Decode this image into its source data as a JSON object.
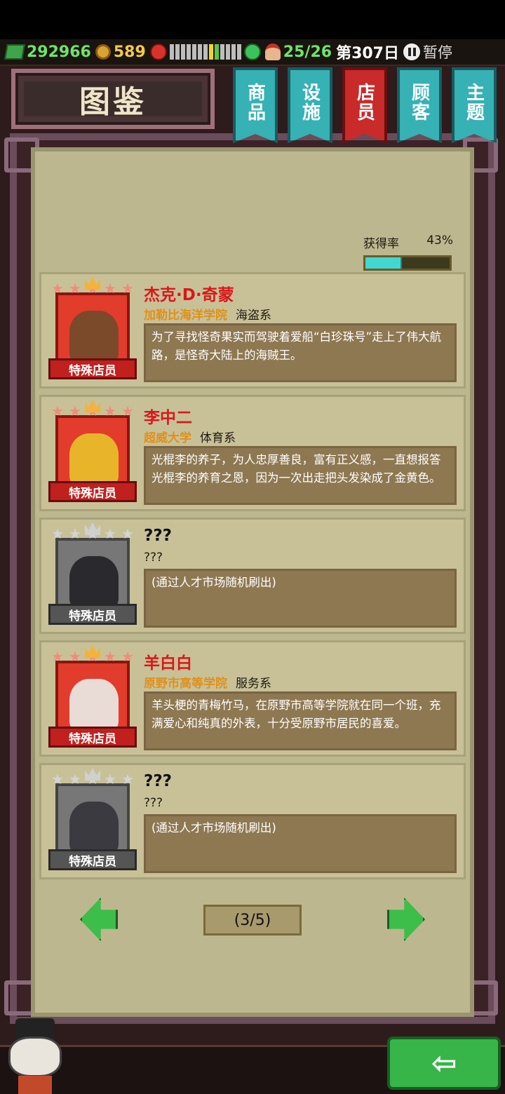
{
  "status": {
    "money": "292966",
    "coins": "589",
    "staff_count": "25/26",
    "day": "第307日",
    "pause": "暂停",
    "colors": {
      "money": "#6fe36a",
      "coins": "#f3c84a"
    }
  },
  "title": "图鉴",
  "tabs": [
    {
      "label": "商品",
      "active": false
    },
    {
      "label": "设施",
      "active": false
    },
    {
      "label": "店员",
      "active": true
    },
    {
      "label": "顾客",
      "active": false
    },
    {
      "label": "主题",
      "active": false
    }
  ],
  "acquisition": {
    "label": "获得率",
    "value": "43%",
    "fraction": 0.43
  },
  "cards": [
    {
      "name": "杰克·D·奇蒙",
      "school": "加勒比海洋学院",
      "dept": "海盗系",
      "desc": "为了寻找怪奇果实而驾驶着爱船“白珍珠号”走上了伟大航路，是怪奇大陆上的海贼王。",
      "badge": "特殊店员",
      "unlocked": true
    },
    {
      "name": "李中二",
      "school": "超威大学",
      "dept": "体育系",
      "desc": "光棍李的养子，为人忠厚善良，富有正义感，一直想报答光棍李的养育之恩，因为一次出走把头发染成了金黄色。",
      "badge": "特殊店员",
      "unlocked": true
    },
    {
      "name": "???",
      "school": "",
      "dept": "???",
      "desc": "(通过人才市场随机刷出)",
      "badge": "特殊店员",
      "unlocked": false
    },
    {
      "name": "羊白白",
      "school": "原野市高等学院",
      "dept": "服务系",
      "desc": "羊头梗的青梅竹马，在原野市高等学院就在同一个班，充满爱心和纯真的外表，十分受原野市居民的喜爱。",
      "badge": "特殊店员",
      "unlocked": true
    },
    {
      "name": "???",
      "school": "",
      "dept": "???",
      "desc": "(通过人才市场随机刷出)",
      "badge": "特殊店员",
      "unlocked": false
    }
  ],
  "pager": {
    "label": "(3/5)"
  }
}
